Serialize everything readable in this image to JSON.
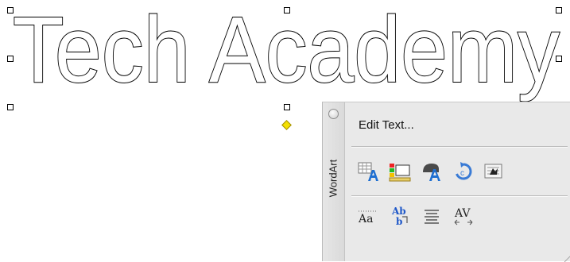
{
  "wordart": {
    "text": "Tech Academy",
    "fill_color": "#ffffff",
    "outline_color": "#000000",
    "adjust_handle_color": "#f3e000"
  },
  "toolbar": {
    "title": "WordArt",
    "edit_text_label": "Edit Text...",
    "row1_icons": [
      "wordart-gallery-icon",
      "format-wordart-icon",
      "wordart-shape-icon",
      "free-rotate-icon",
      "text-wrapping-icon"
    ],
    "row2_icons": [
      "same-letter-heights-icon",
      "vertical-text-icon",
      "alignment-icon",
      "character-spacing-icon"
    ]
  }
}
